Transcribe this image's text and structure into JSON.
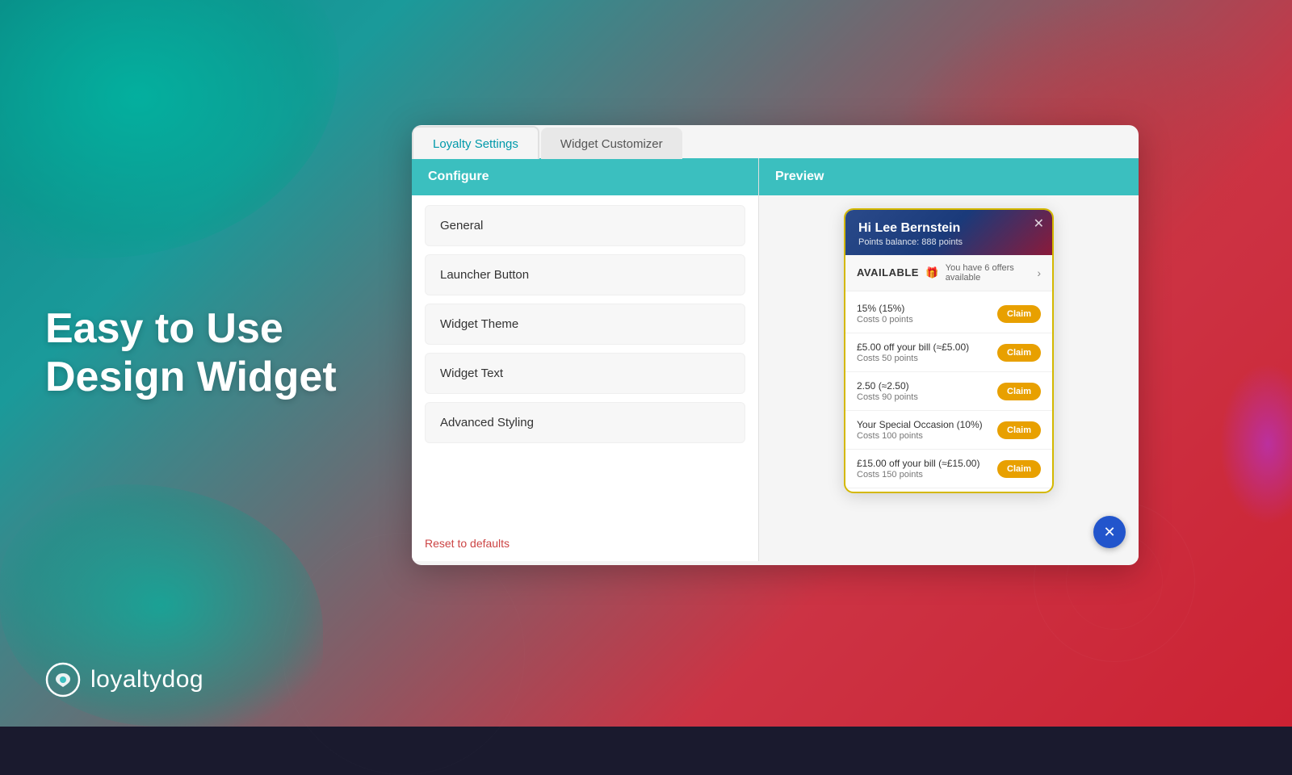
{
  "background": {
    "base_color": "#1a9a9a"
  },
  "hero": {
    "line1": "Easy to Use",
    "line2": "Design Widget"
  },
  "logo": {
    "text": "loyaltydog"
  },
  "tabs": [
    {
      "id": "loyalty-settings",
      "label": "Loyalty Settings",
      "active": true
    },
    {
      "id": "widget-customizer",
      "label": "Widget Customizer",
      "active": false
    }
  ],
  "configure": {
    "header": "Configure",
    "items": [
      {
        "id": "general",
        "label": "General"
      },
      {
        "id": "launcher-button",
        "label": "Launcher Button"
      },
      {
        "id": "widget-theme",
        "label": "Widget Theme"
      },
      {
        "id": "widget-text",
        "label": "Widget Text"
      },
      {
        "id": "advanced-styling",
        "label": "Advanced Styling"
      }
    ],
    "reset_label": "Reset to defaults"
  },
  "preview": {
    "header": "Preview",
    "widget": {
      "greeting": "Hi Lee Bernstein",
      "points_label": "Points balance: 888 points",
      "available_title": "AVAILABLE",
      "available_subtitle": "You have 6 offers available",
      "offers": [
        {
          "title": "15% (15%)",
          "cost": "Costs 0 points",
          "claim_label": "Claim"
        },
        {
          "title": "£5.00 off your bill (≈£5.00)",
          "cost": "Costs 50 points",
          "claim_label": "Claim"
        },
        {
          "title": "2.50 (≈2.50)",
          "cost": "Costs 90 points",
          "claim_label": "Claim"
        },
        {
          "title": "Your Special Occasion (10%)",
          "cost": "Costs 100 points",
          "claim_label": "Claim"
        },
        {
          "title": "£15.00 off your bill (≈£15.00)",
          "cost": "Costs 150 points",
          "claim_label": "Claim"
        }
      ]
    }
  }
}
